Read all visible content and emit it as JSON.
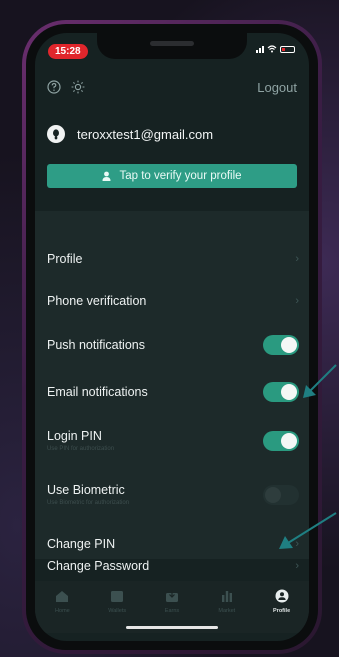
{
  "status_bar": {
    "time": "15:28"
  },
  "header": {
    "logout_label": "Logout"
  },
  "user": {
    "email": "teroxxtest1@gmail.com"
  },
  "verify_button": {
    "label": "Tap to verify your profile"
  },
  "settings": {
    "profile": {
      "label": "Profile"
    },
    "phone_verification": {
      "label": "Phone verification"
    },
    "push_notifications": {
      "label": "Push notifications",
      "enabled": true
    },
    "email_notifications": {
      "label": "Email notifications",
      "enabled": true
    },
    "login_pin": {
      "label": "Login PIN",
      "sublabel": "Use PIN for authorization",
      "enabled": true
    },
    "use_biometric": {
      "label": "Use Biometric",
      "sublabel": "Use Biometric for authorization",
      "enabled": false
    },
    "change_pin": {
      "label": "Change PIN"
    },
    "change_password": {
      "label": "Change Password"
    }
  },
  "tabbar": {
    "home": "Home",
    "wallets": "Wallets",
    "earns": "Earns",
    "market": "Market",
    "profile": "Profile"
  },
  "colors": {
    "accent": "#2e9d86",
    "toggle_on": "#2a9a80",
    "annotation_arrow": "#1f7f82",
    "time_pill": "#e0262c"
  },
  "icons": {
    "help": "help-icon",
    "theme": "sun-icon",
    "avatar": "user-avatar-icon",
    "verify": "person-icon",
    "chevron": "chevron-right-icon"
  }
}
